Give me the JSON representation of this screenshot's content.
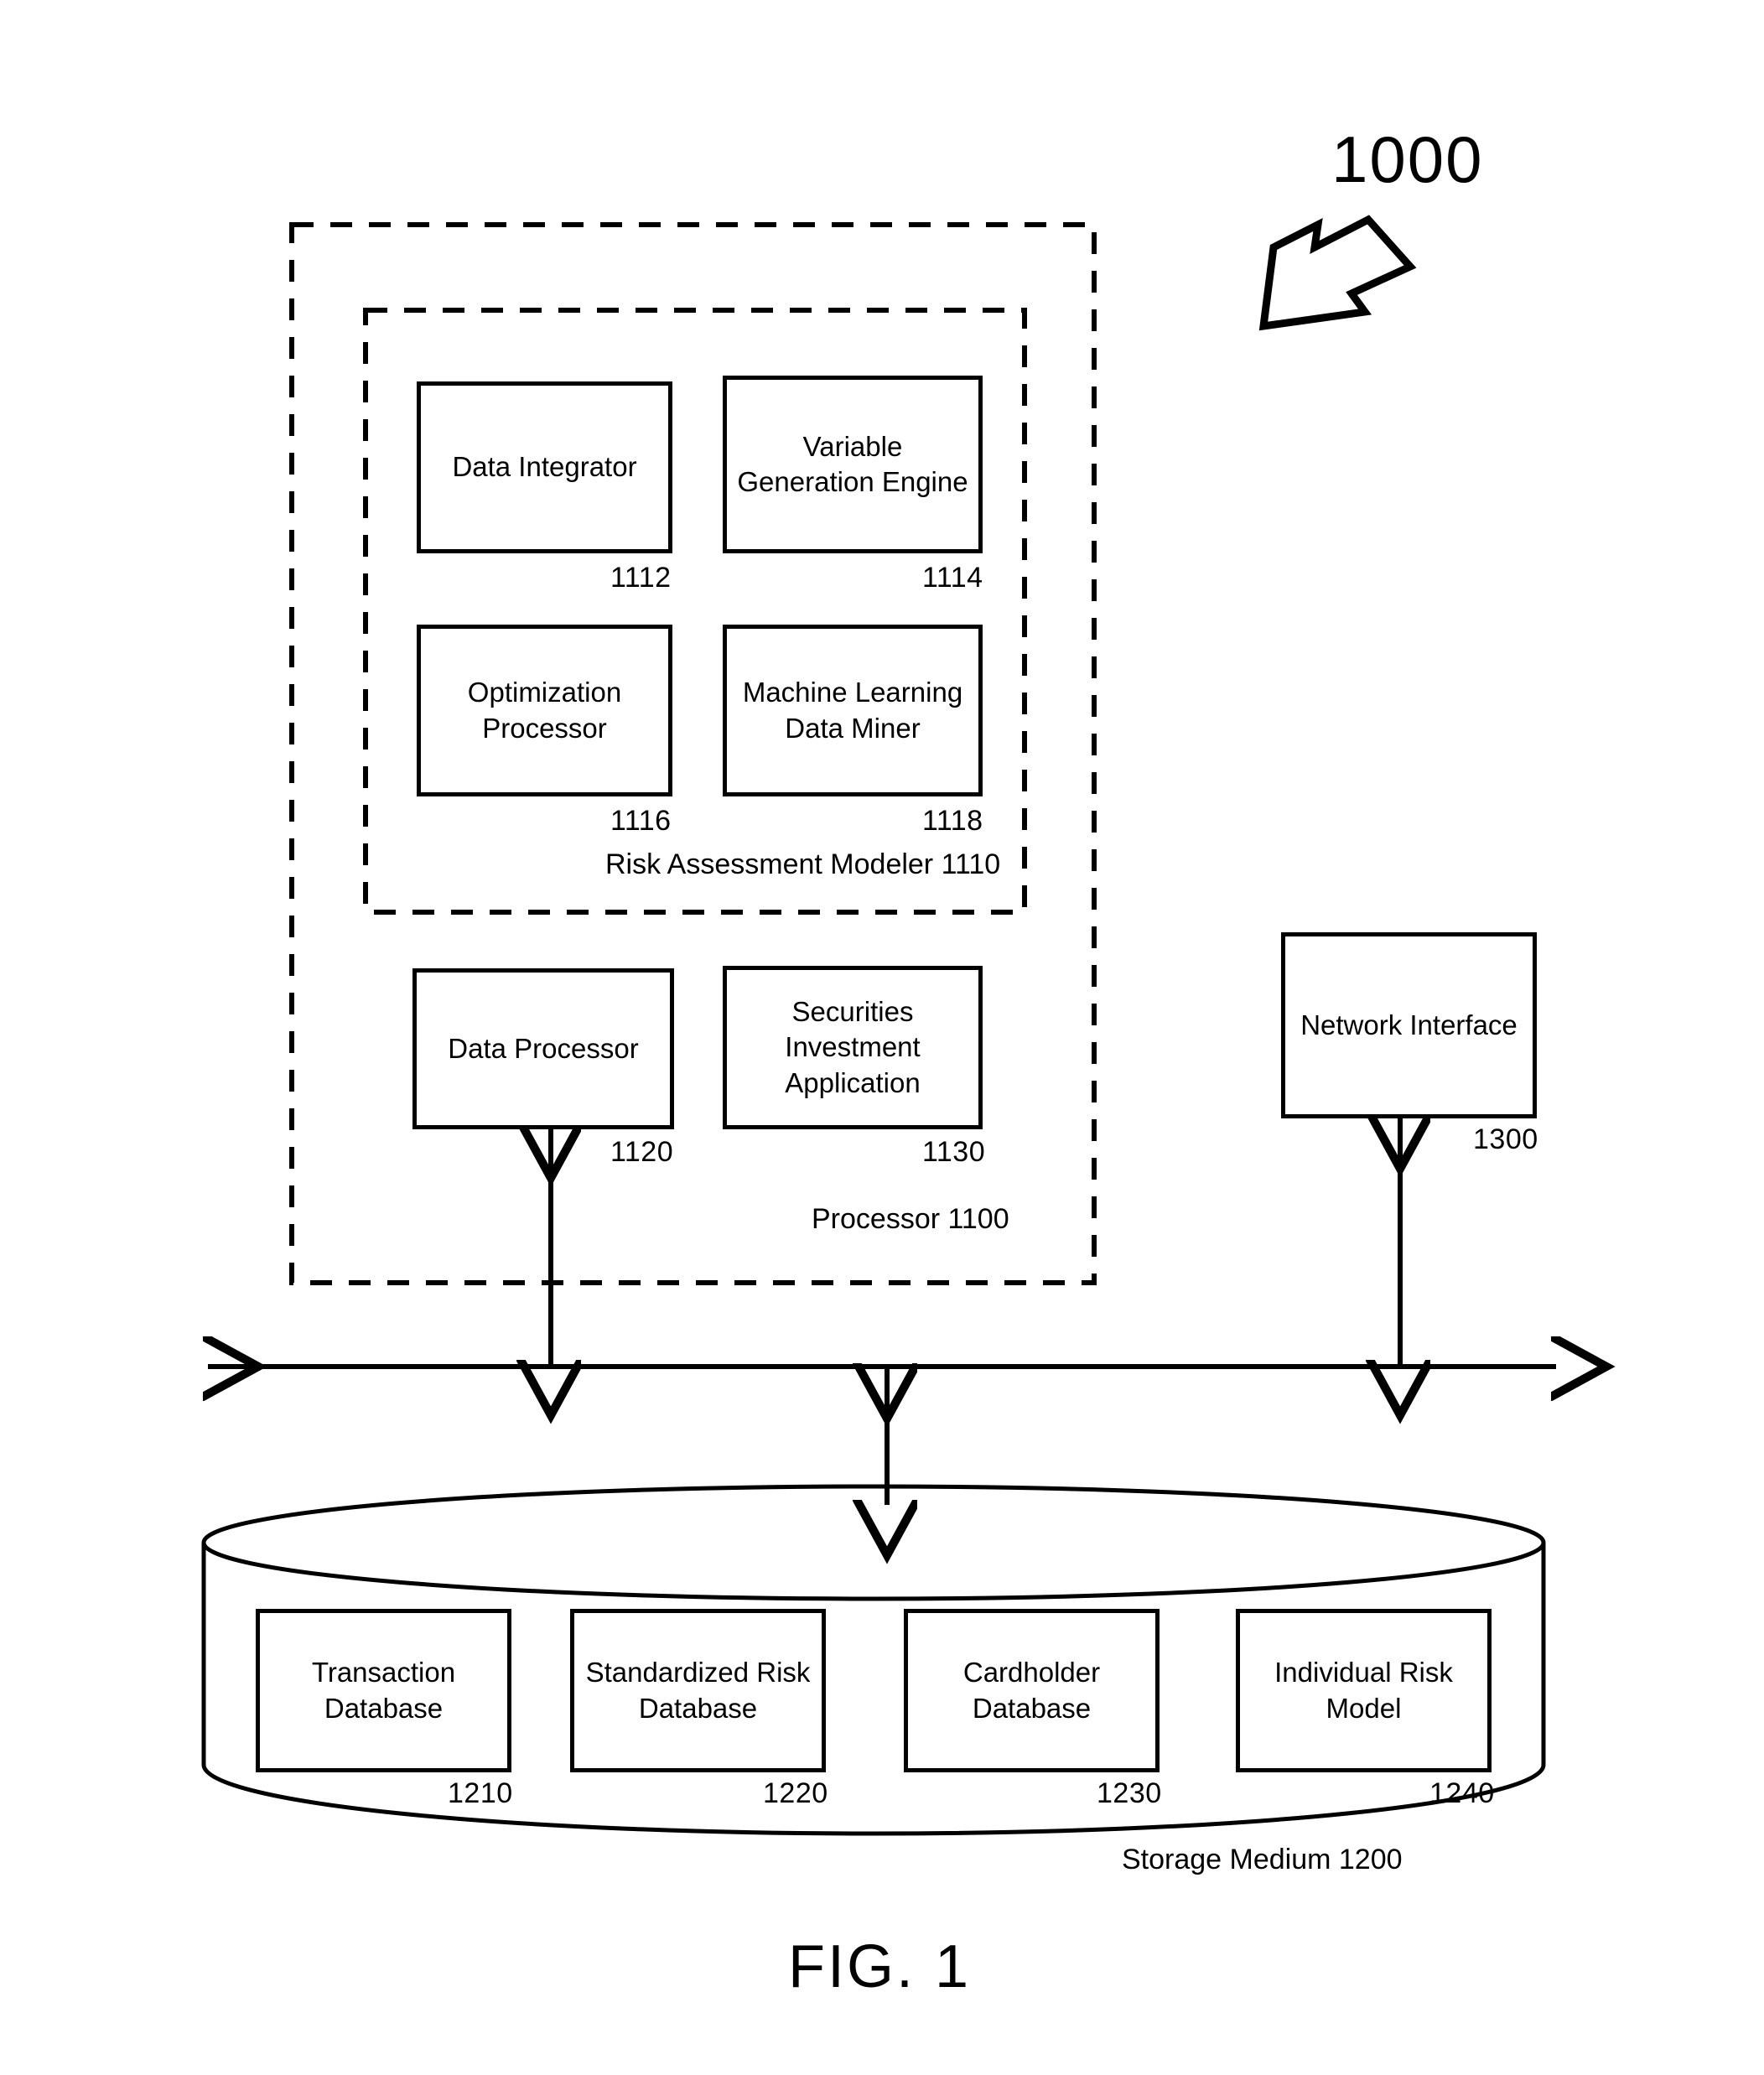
{
  "figure": {
    "caption": "FIG. 1",
    "system_callout": "1000"
  },
  "processor": {
    "caption": "Processor 1100",
    "modeler": {
      "caption": "Risk Assessment Modeler 1110",
      "modules": [
        {
          "label": "Data Integrator",
          "ref": "1112"
        },
        {
          "label": "Variable Generation Engine",
          "ref": "1114"
        },
        {
          "label": "Optimization Processor",
          "ref": "1116"
        },
        {
          "label": "Machine Learning Data Miner",
          "ref": "1118"
        }
      ]
    },
    "components": [
      {
        "label": "Data Processor",
        "ref": "1120"
      },
      {
        "label": "Securities Investment Application",
        "ref": "1130"
      }
    ]
  },
  "network_interface": {
    "label": "Network Interface",
    "ref": "1300"
  },
  "storage_medium": {
    "caption": "Storage Medium 1200",
    "databases": [
      {
        "label": "Transaction Database",
        "ref": "1210"
      },
      {
        "label": "Standardized Risk Database",
        "ref": "1220"
      },
      {
        "label": "Cardholder Database",
        "ref": "1230"
      },
      {
        "label": "Individual Risk Model",
        "ref": "1240"
      }
    ]
  },
  "icons": {
    "system_pointer": "hollow-arrow-icon",
    "bus": "bidirectional-bus-icon"
  },
  "colors": {
    "stroke": "#000000",
    "background": "#ffffff"
  }
}
